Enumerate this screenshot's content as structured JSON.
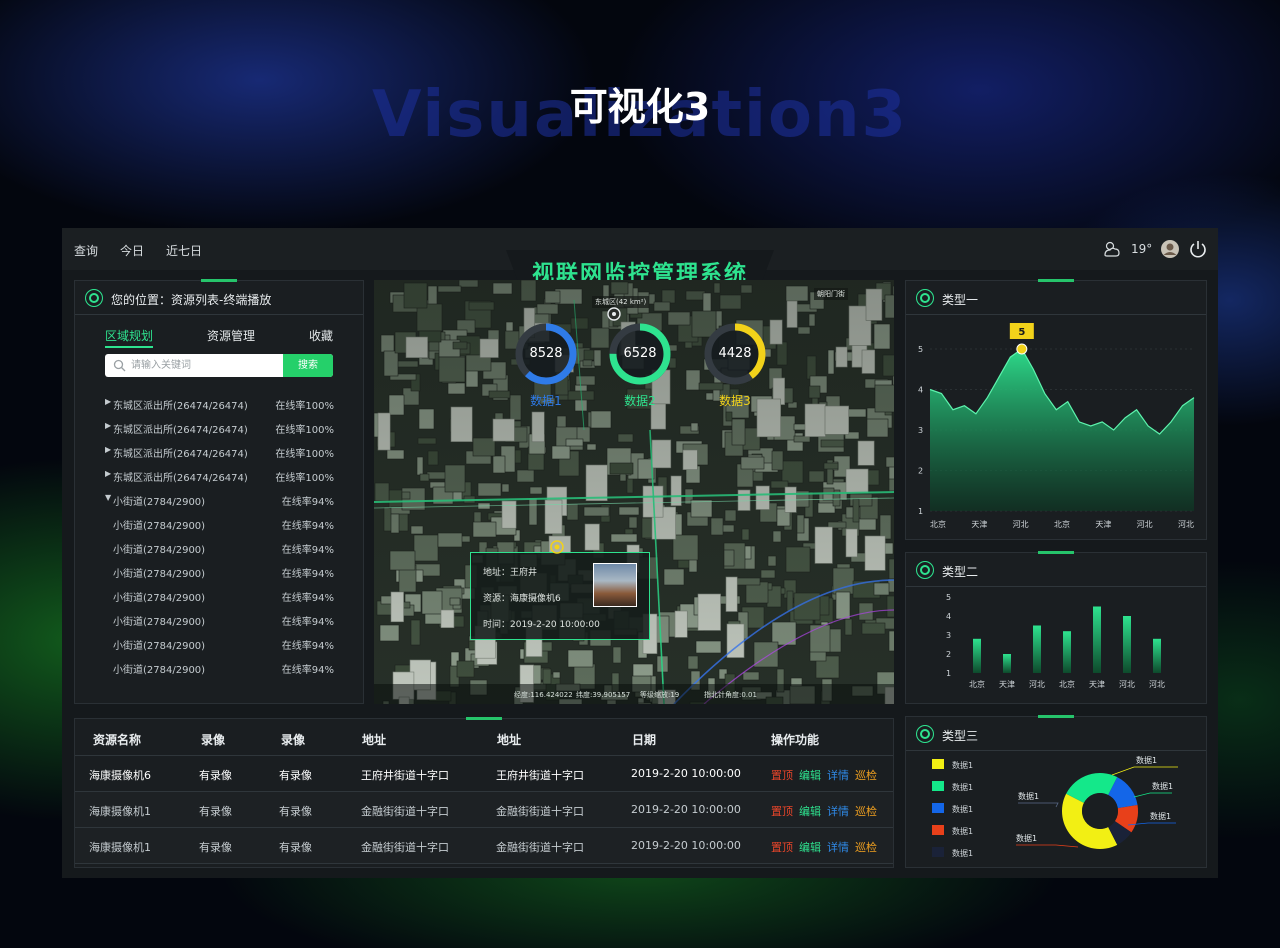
{
  "hero": {
    "title": "可视化3",
    "shadow_text": "Visualization3"
  },
  "topbar": {
    "nav": [
      "查询",
      "今日",
      "近七日"
    ],
    "temperature": "19°",
    "icons": [
      "cloud-sun-icon",
      "avatar",
      "power-icon"
    ]
  },
  "system_title": "视联网监控管理系统",
  "left_panel": {
    "location": "您的位置：资源列表-终端播放",
    "tabs": [
      "区域规划",
      "资源管理",
      "收藏"
    ],
    "active_tab": "区域规划",
    "search": {
      "placeholder": "请输入关键词",
      "button": "搜索"
    },
    "tree": [
      {
        "name": "东城区派出所(26474/26474)",
        "rate": "在线率100%",
        "type": "collapsed"
      },
      {
        "name": "东城区派出所(26474/26474)",
        "rate": "在线率100%",
        "type": "collapsed"
      },
      {
        "name": "东城区派出所(26474/26474)",
        "rate": "在线率100%",
        "type": "collapsed"
      },
      {
        "name": "东城区派出所(26474/26474)",
        "rate": "在线率100%",
        "type": "collapsed"
      },
      {
        "name": "小街道(2784/2900)",
        "rate": "在线率94%",
        "type": "expanded"
      },
      {
        "name": "小街道(2784/2900)",
        "rate": "在线率94%",
        "type": "child"
      },
      {
        "name": "小街道(2784/2900)",
        "rate": "在线率94%",
        "type": "child"
      },
      {
        "name": "小街道(2784/2900)",
        "rate": "在线率94%",
        "type": "child"
      },
      {
        "name": "小街道(2784/2900)",
        "rate": "在线率94%",
        "type": "child"
      },
      {
        "name": "小街道(2784/2900)",
        "rate": "在线率94%",
        "type": "child"
      },
      {
        "name": "小街道(2784/2900)",
        "rate": "在线率94%",
        "type": "child"
      },
      {
        "name": "小街道(2784/2900)",
        "rate": "在线率94%",
        "type": "child"
      }
    ]
  },
  "map": {
    "area_label": "东城区(42 km²)",
    "corner_label": "朝阳门街",
    "gauges": [
      {
        "value": "8528",
        "label": "数据1",
        "color": "#2f7be8",
        "fraction": 0.62
      },
      {
        "value": "6528",
        "label": "数据2",
        "color": "#2ee38f",
        "fraction": 0.75
      },
      {
        "value": "4428",
        "label": "数据3",
        "color": "#f2d21a",
        "fraction": 0.4
      }
    ],
    "popup": {
      "address": "地址：王府井",
      "resource": "资源：海康摄像机6",
      "time": "时间：2019-2-20 10:00:00"
    },
    "status": [
      "经度:116.424022",
      "纬度:39.905157",
      "等级缩放:19",
      "指北针角度:0.01"
    ]
  },
  "table": {
    "headers": [
      "资源名称",
      "录像",
      "录像",
      "地址",
      "地址",
      "日期",
      "操作功能"
    ],
    "rows": [
      [
        "海康摄像机6",
        "有录像",
        "有录像",
        "王府井街道十字口",
        "王府井街道十字口",
        "2019-2-20 10:00:00"
      ],
      [
        "海康摄像机1",
        "有录像",
        "有录像",
        "金融街街道十字口",
        "金融街街道十字口",
        "2019-2-20 10:00:00"
      ],
      [
        "海康摄像机1",
        "有录像",
        "有录像",
        "金融街街道十字口",
        "金融街街道十字口",
        "2019-2-20 10:00:00"
      ]
    ],
    "ops": [
      {
        "label": "置顶",
        "color": "#e8452a"
      },
      {
        "label": "编辑",
        "color": "#2ee38f"
      },
      {
        "label": "详情",
        "color": "#2f8ae8"
      },
      {
        "label": "巡检",
        "color": "#f0a020"
      }
    ]
  },
  "right_panels": {
    "type1": "类型一",
    "type2": "类型二",
    "type3": "类型三"
  },
  "chart_data": [
    {
      "type": "area",
      "title": "类型一",
      "categories": [
        "北京",
        "天津",
        "河北",
        "北京",
        "天津",
        "河北",
        "河北"
      ],
      "values": [
        4.0,
        3.4,
        4.3,
        3.5,
        3.2,
        3.0,
        3.8
      ],
      "peak_label": "5",
      "peak_value": 5,
      "ylim": [
        1,
        5
      ],
      "yticks": [
        1,
        2,
        3,
        4,
        5
      ],
      "color": "#2ee38f"
    },
    {
      "type": "bar",
      "title": "类型二",
      "categories": [
        "北京",
        "天津",
        "河北",
        "北京",
        "天津",
        "河北",
        "河北"
      ],
      "values": [
        1.8,
        1.0,
        2.5,
        2.2,
        3.5,
        3.0,
        1.8
      ],
      "ylim": [
        1,
        5
      ],
      "yticks": [
        1,
        2,
        3,
        4,
        5
      ],
      "color": "#2ee38f"
    },
    {
      "type": "pie",
      "title": "类型三",
      "legend": [
        "数据1",
        "数据1",
        "数据1",
        "数据1",
        "数据1"
      ],
      "colors": [
        "#f2ef14",
        "#14e88a",
        "#1466e8",
        "#e8401a",
        "#1a2238"
      ],
      "values": [
        40,
        25,
        15,
        12,
        8
      ],
      "slice_labels": [
        "数据1",
        "数据1",
        "数据1",
        "数据1",
        "数据1"
      ],
      "legend_position": "left"
    }
  ]
}
